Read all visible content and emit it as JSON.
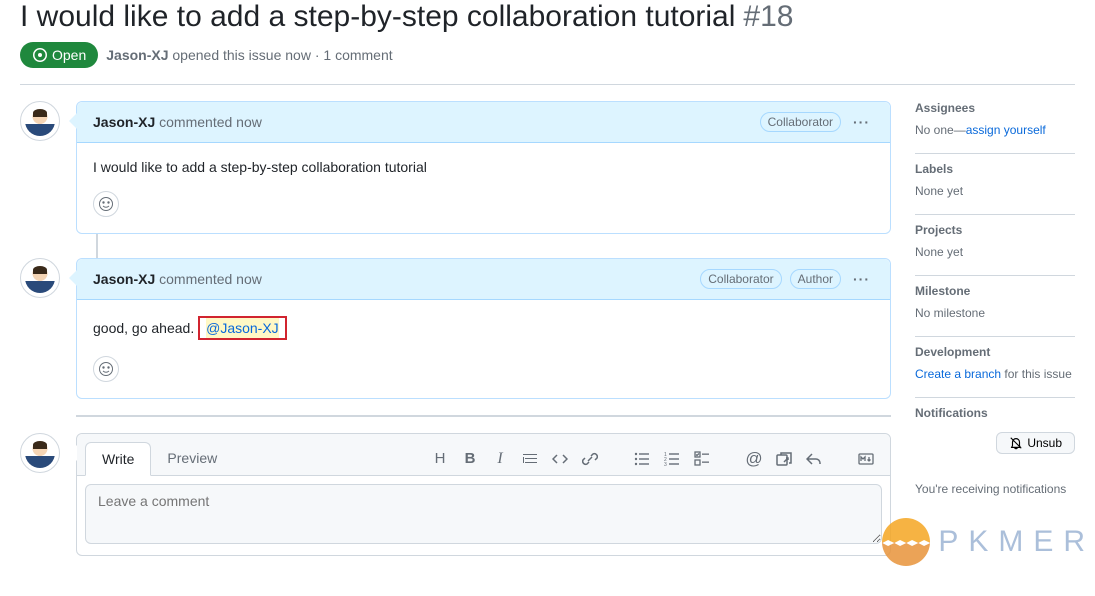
{
  "issue": {
    "title": "I would like to add a step-by-step collaboration tutorial",
    "number": "#18",
    "state": "Open",
    "author": "Jason-XJ",
    "opened_text": "opened this issue now",
    "comment_count": "1 comment"
  },
  "comments": [
    {
      "author": "Jason-XJ",
      "action": "commented now",
      "badges": [
        "Collaborator"
      ],
      "body": "I would like to add a step-by-step collaboration tutorial"
    },
    {
      "author": "Jason-XJ",
      "action": "commented now",
      "badges": [
        "Collaborator",
        "Author"
      ],
      "body_prefix": "good, go ahead.",
      "mention": "@Jason-XJ"
    }
  ],
  "compose": {
    "tabs": {
      "write": "Write",
      "preview": "Preview"
    },
    "placeholder": "Leave a comment"
  },
  "sidebar": {
    "assignees": {
      "title": "Assignees",
      "text_prefix": "No one—",
      "link": "assign yourself"
    },
    "labels": {
      "title": "Labels",
      "text": "None yet"
    },
    "projects": {
      "title": "Projects",
      "text": "None yet"
    },
    "milestone": {
      "title": "Milestone",
      "text": "No milestone"
    },
    "development": {
      "title": "Development",
      "link": "Create a branch",
      "text_suffix": " for this issue"
    },
    "notifications": {
      "title": "Notifications",
      "button": "Unsub",
      "footer": "You're receiving notifications"
    }
  },
  "watermark": "PKMER"
}
